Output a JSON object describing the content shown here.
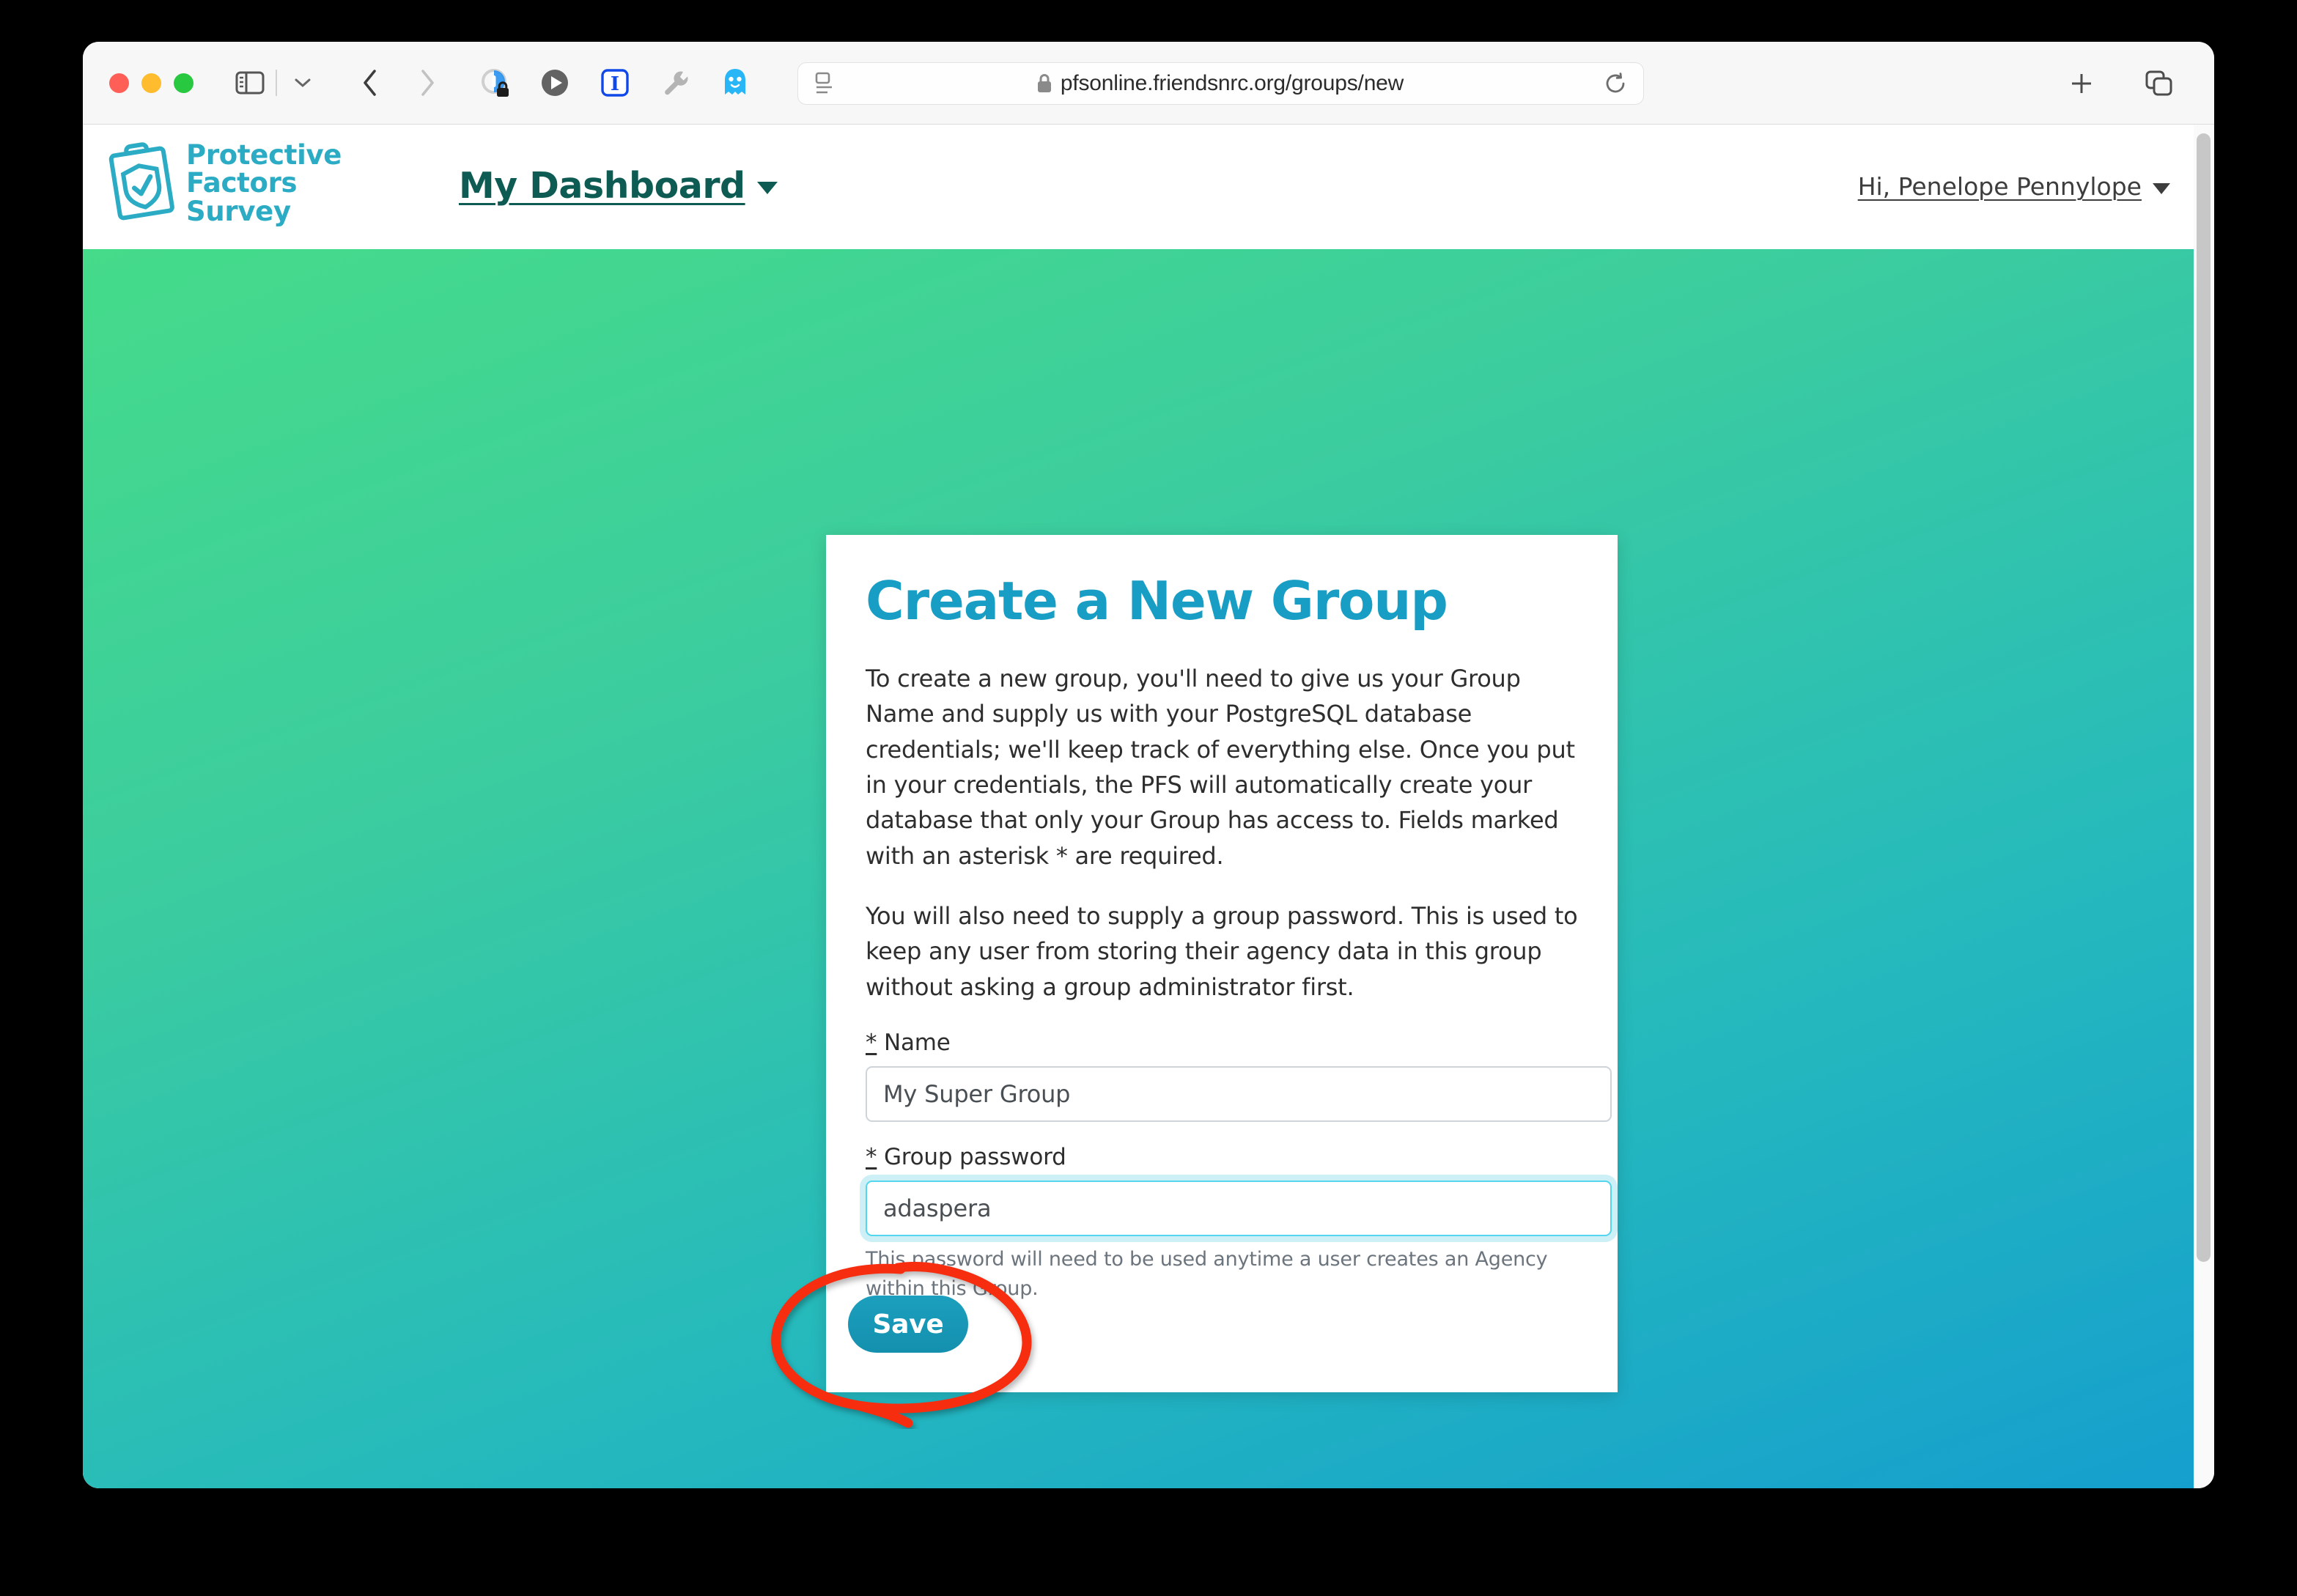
{
  "browser": {
    "window_controls": [
      "close",
      "minimize",
      "zoom"
    ],
    "sidebar_icon": "sidebar-toggle-icon",
    "tab_overview_chevron": "chevron-down-icon",
    "back_icon": "back-arrow-icon",
    "forward_icon": "forward-arrow-icon",
    "extensions": [
      "privacy-lock-icon",
      "play-button-icon",
      "italic-i-extension-icon",
      "wrench-icon",
      "ghostery-ghost-icon"
    ],
    "reader_icon": "reader-view-icon",
    "lock_icon": "secure-lock-icon",
    "url": "pfsonline.friendsnrc.org/groups/new",
    "reload_icon": "reload-icon",
    "new_tab_icon": "plus-icon",
    "tab_overview_icon": "tab-overview-icon"
  },
  "site_header": {
    "logo_icon": "clipboard-shield-check-logo",
    "brand_line1": "Protective",
    "brand_line2": "Factors",
    "brand_line3": "Survey",
    "nav_dashboard": "My Dashboard",
    "nav_dashboard_caret": "caret-down-icon",
    "user_menu": "Hi, Penelope Pennylope",
    "user_menu_caret": "caret-down-icon"
  },
  "card": {
    "title": "Create a New Group",
    "paragraph1": "To create a new group, you'll need to give us your Group Name and supply us with your PostgreSQL database credentials; we'll keep track of everything else. Once you put in your credentials, the PFS will automatically create your database that only your Group has access to. Fields marked with an asterisk * are required.",
    "paragraph2": "You will also need to supply a group password. This is used to keep any user from storing their agency data in this group without asking a group administrator first.",
    "name_label_star": "*",
    "name_label": "Name",
    "name_value": "My Super Group",
    "password_label_star": "*",
    "password_label": "Group password",
    "password_value": "adaspera",
    "password_help": "This password will need to be used anytime a user creates an Agency within this Group.",
    "save_label": "Save"
  },
  "annotation": {
    "shape": "hand-drawn-red-ellipse",
    "color": "#f72d10",
    "target": "Save"
  },
  "colors": {
    "brand_teal": "#2bacc4",
    "title_blue": "#189ec4",
    "nav_dark_teal": "#0d5b53",
    "gradient_top_right": "#45db8a",
    "gradient_bottom_left": "#159fce",
    "save_button": "#1490ae",
    "focus_ring": "#53d6ee",
    "annotation_red": "#f72d10"
  }
}
